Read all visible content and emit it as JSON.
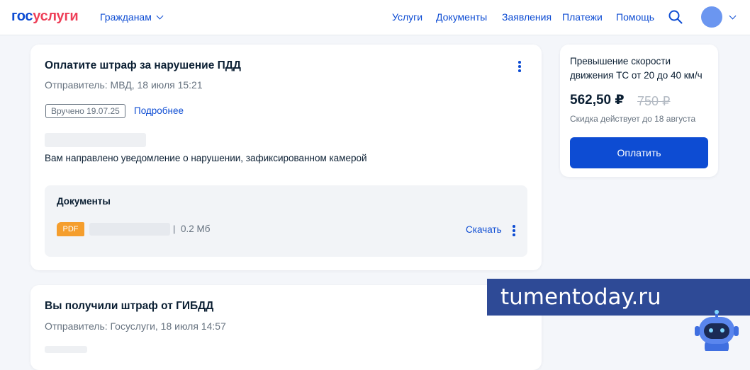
{
  "header": {
    "logo_part1": "гос",
    "logo_part2": "услуги",
    "audience_menu": "Гражданам",
    "nav": [
      "Услуги",
      "Документы",
      "Заявления",
      "Платежи",
      "Помощь"
    ],
    "icons": [
      "search-icon",
      "avatar",
      "chevron-down-icon"
    ]
  },
  "notification": {
    "title": "Оплатите штраф за нарушение ПДД",
    "sender": "Отправитель: МВД, 18 июля 15:21",
    "status_badge": "Вручено 19.07.25",
    "more_link": "Подробнее",
    "message": "Вам направлено уведомление о нарушении, зафиксированном камерой",
    "documents": {
      "title": "Документы",
      "file_type": "PDF",
      "separator": "|",
      "file_size": "0.2 Мб",
      "download_label": "Скачать"
    }
  },
  "notification2": {
    "title": "Вы получили штраф от ГИБДД",
    "sender": "Отправитель: Госуслуги, 18 июля 14:57"
  },
  "payment": {
    "title": "Превышение скорости движения ТС от 20 до 40 км/ч",
    "price": "562,50 ₽",
    "old_price": "750 ₽",
    "discount_note": "Скидка действует до 18 августа",
    "pay_button": "Оплатить"
  },
  "watermark": {
    "text": "tumentoday.ru"
  },
  "colors": {
    "accent": "#0d4cd3",
    "logo_red": "#ee3f58",
    "pdf_orange": "#f59e2d",
    "watermark_bg": "#2e4a96"
  }
}
